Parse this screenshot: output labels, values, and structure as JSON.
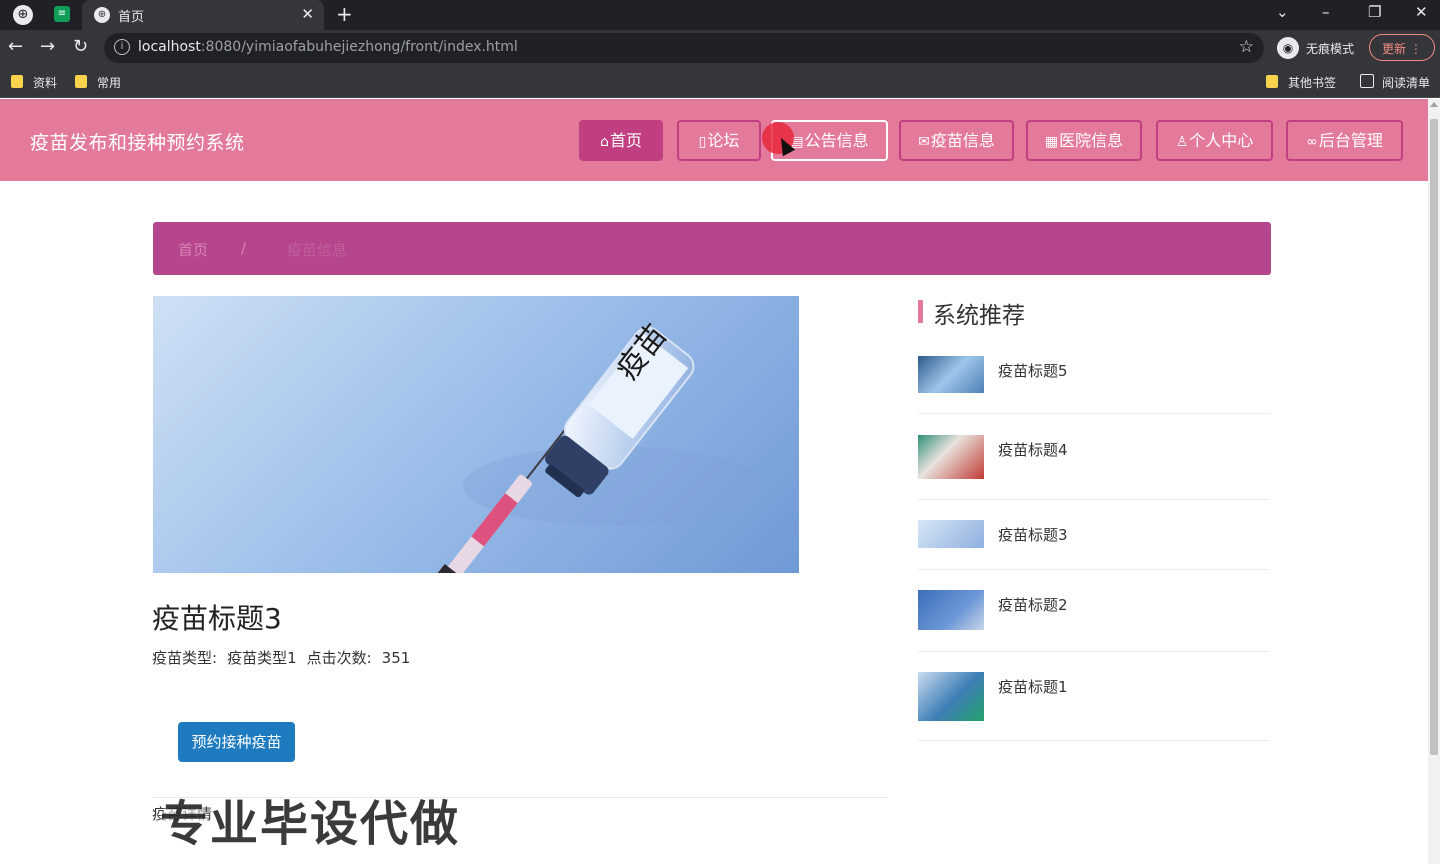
{
  "browser": {
    "tab_title": "首页",
    "url_host": "localhost",
    "url_rest": ":8080/yimiaofabuhejiezhong/front/index.html",
    "incognito_label": "无痕模式",
    "update_label": "更新",
    "bookmarks": [
      "资料",
      "常用"
    ],
    "bookmarks_right": [
      "其他书签",
      "阅读清单"
    ]
  },
  "header": {
    "site_title": "疫苗发布和接种预约系统",
    "nav": [
      {
        "label": "首页",
        "icon": "home-icon"
      },
      {
        "label": "论坛",
        "icon": "edit-icon"
      },
      {
        "label": "公告信息",
        "icon": "notice-icon"
      },
      {
        "label": "疫苗信息",
        "icon": "mail-icon"
      },
      {
        "label": "医院信息",
        "icon": "calendar-icon"
      },
      {
        "label": "个人中心",
        "icon": "user-icon"
      },
      {
        "label": "后台管理",
        "icon": "link-icon"
      }
    ],
    "active_color": "#c13f80",
    "bg_color": "#e47a9a"
  },
  "breadcrumb": {
    "home": "首页",
    "sep": "/",
    "current": "疫苗信息"
  },
  "detail": {
    "image_label": "疫苗",
    "title": "疫苗标题3",
    "type_label": "疫苗类型:",
    "type_value": "疫苗类型1",
    "clicks_label": "点击次数:",
    "clicks_value": "351",
    "book_button": "预约接种疫苗",
    "content_label": "疫苗详情",
    "watermark": "专业毕设代做"
  },
  "sidebar": {
    "heading": "系统推荐",
    "items": [
      {
        "title": "疫苗标题5"
      },
      {
        "title": "疫苗标题4"
      },
      {
        "title": "疫苗标题3"
      },
      {
        "title": "疫苗标题2"
      },
      {
        "title": "疫苗标题1"
      }
    ]
  }
}
